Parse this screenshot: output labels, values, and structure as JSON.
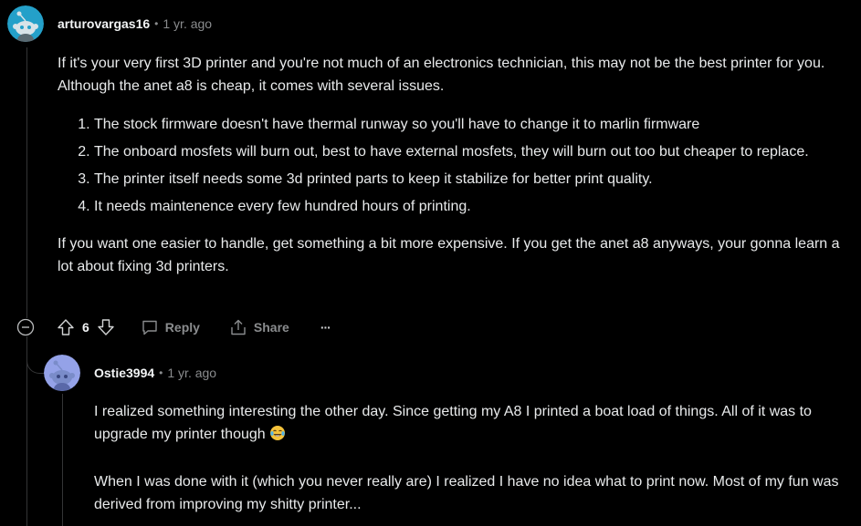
{
  "comment": {
    "username": "arturovargas16",
    "separator": "•",
    "time": "1 yr. ago",
    "intro": "If it's your very first 3D printer and you're not much of an electronics technician, this may not be the best printer for you. Although the anet a8 is cheap, it comes with several issues.",
    "list": [
      "The stock firmware doesn't have thermal runway so you'll have to change it to marlin firmware",
      "The onboard mosfets will burn out, best to have external mosfets, they will burn out too but cheaper to replace.",
      "The printer itself needs some 3d printed parts to keep it stabilize for better print quality.",
      "It needs maintenence every few hundred hours of printing."
    ],
    "outro": "If you want one easier to handle, get something a bit more expensive. If you get the anet a8 anyways, your gonna learn a lot about fixing 3d printers.",
    "votes": "6",
    "reply_label": "Reply",
    "share_label": "Share",
    "more_label": "···",
    "avatar_color": "#24a0c9"
  },
  "reply": {
    "username": "Ostie3994",
    "separator": "•",
    "time": "1 yr. ago",
    "para1": "I realized something interesting the other day. Since getting my A8 I printed a boat load of things. All of it was to upgrade my printer though",
    "para2": "When I was done with it (which you never really are) I realized I have no idea what to print now. Most of my fun was derived from improving my shitty printer...",
    "avatar_color": "#94a2e8"
  },
  "icons": {
    "collapse": "collapse-minus-icon",
    "upvote": "upvote-arrow-icon",
    "downvote": "downvote-arrow-icon",
    "reply": "speech-bubble-icon",
    "share": "share-icon",
    "emoji": "laughing-tears-emoji-icon"
  }
}
